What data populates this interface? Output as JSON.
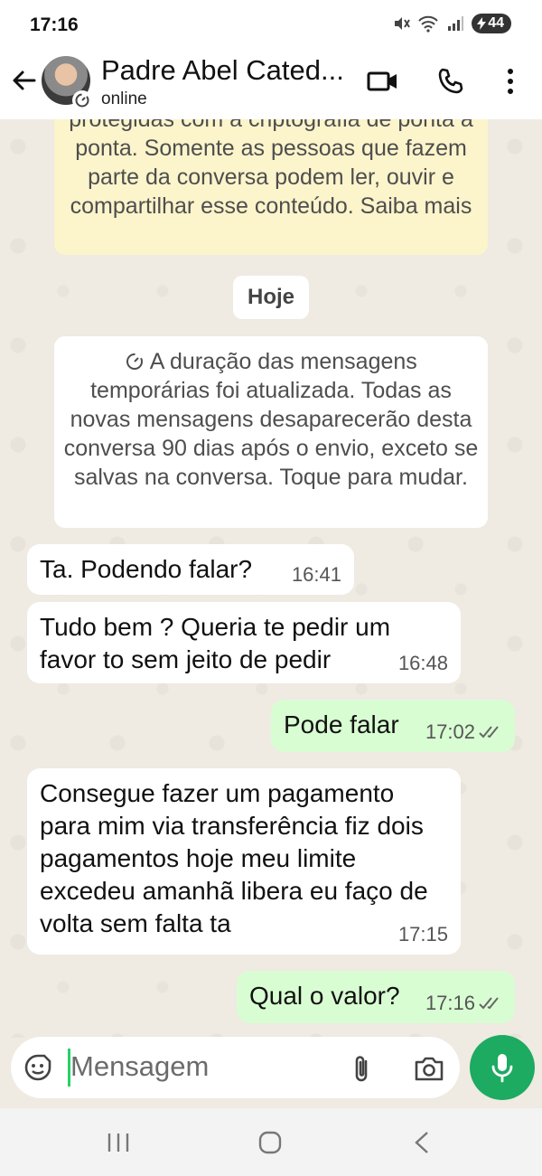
{
  "status_bar": {
    "time": "17:16",
    "battery": "44"
  },
  "header": {
    "contact_name": "Padre Abel Cated...",
    "status": "online"
  },
  "chat": {
    "encryption_notice": "protegidas com a criptografia de ponta a ponta. Somente as pessoas que fazem parte da conversa podem ler, ouvir e compartilhar esse conteúdo. Saiba mais",
    "day_label": "Hoje",
    "system_message": "A duração das mensagens temporárias foi atualizada. Todas as novas mensagens desaparecerão desta conversa 90 dias após o envio, exceto se salvas na conversa. Toque para mudar.",
    "messages": [
      {
        "direction": "in",
        "text": "Ta. Podendo falar?",
        "time": "16:41"
      },
      {
        "direction": "in",
        "text": "Tudo bem ? Queria te pedir um favor to sem jeito de pedir",
        "time": "16:48"
      },
      {
        "direction": "out",
        "text": "Pode falar",
        "time": "17:02"
      },
      {
        "direction": "in",
        "text": "Consegue fazer um pagamento para mim via transferência fiz dois pagamentos hoje meu limite excedeu amanhã libera eu faço de volta sem falta ta",
        "time": "17:15"
      },
      {
        "direction": "out",
        "text": "Qual o valor?",
        "time": "17:16"
      }
    ]
  },
  "composer": {
    "placeholder": "Mensagem"
  },
  "icons": {
    "back": "back-arrow-icon",
    "video": "video-call-icon",
    "phone": "phone-icon",
    "menu": "more-vert-icon",
    "emoji": "sticker-icon",
    "attach": "paperclip-icon",
    "camera": "camera-icon",
    "mic": "mic-icon"
  },
  "colors": {
    "outgoing": "#d9fdd3",
    "incoming": "#ffffff",
    "accent": "#1daa61",
    "encryption_bg": "#fcf4cb"
  }
}
